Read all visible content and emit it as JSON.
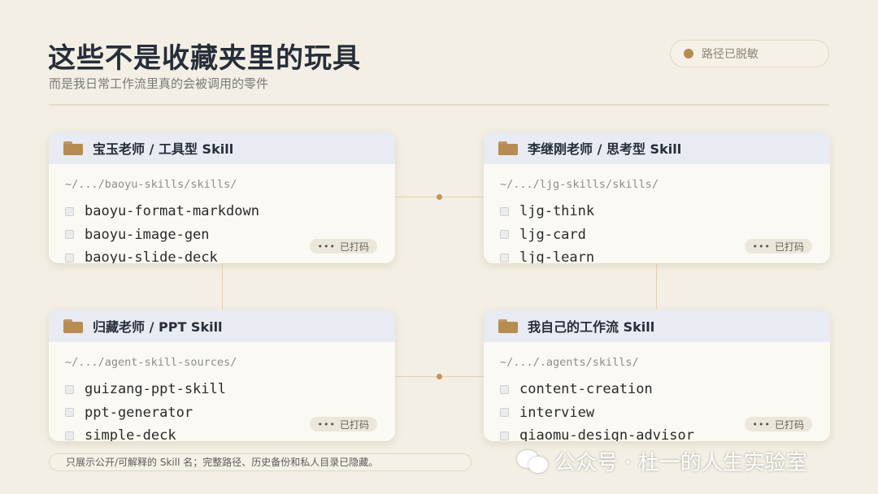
{
  "header": {
    "title": "这些不是收藏夹里的玩具",
    "subtitle": "而是我日常工作流里真的会被调用的零件",
    "status_pill": "路径已脱敏"
  },
  "cards": [
    {
      "title": "宝玉老师 / 工具型 Skill",
      "path": "~/.../baoyu-skills/skills/",
      "items": [
        "baoyu-format-markdown",
        "baoyu-image-gen",
        "baoyu-slide-deck"
      ],
      "badge": "已打码",
      "icon": "folder-icon"
    },
    {
      "title": "李继刚老师 / 思考型 Skill",
      "path": "~/.../ljg-skills/skills/",
      "items": [
        "ljg-think",
        "ljg-card",
        "ljg-learn"
      ],
      "badge": "已打码",
      "icon": "folder-icon"
    },
    {
      "title": "归藏老师 / PPT Skill",
      "path": "~/.../agent-skill-sources/",
      "items": [
        "guizang-ppt-skill",
        "ppt-generator",
        "simple-deck"
      ],
      "badge": "已打码",
      "icon": "folder-icon"
    },
    {
      "title": "我自己的工作流 Skill",
      "path": "~/.../.agents/skills/",
      "items": [
        "content-creation",
        "interview",
        "qiaomu-design-advisor"
      ],
      "badge": "已打码",
      "icon": "folder-icon"
    }
  ],
  "footnote": "只展示公开/可解释的 Skill 名；完整路径、历史备份和私人目录已隐藏。",
  "watermark": "公众号 · 杜一的人生实验室",
  "colors": {
    "background": "#f3efe4",
    "accent": "#b48c52",
    "card_header": "#e8ebf1",
    "title": "#262e3a"
  }
}
